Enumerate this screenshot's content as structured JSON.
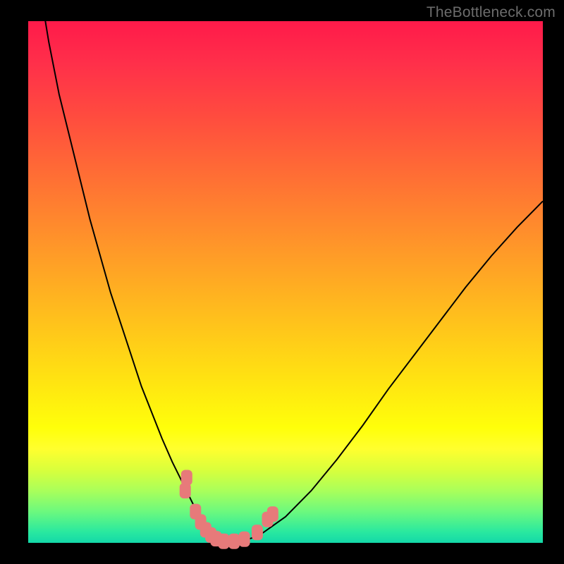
{
  "watermark": "TheBottleneck.com",
  "colors": {
    "frame_bg": "#000000",
    "gradient_top": "#ff1a4a",
    "gradient_bottom": "#14d8a8",
    "curve_stroke": "#000000",
    "marker_fill": "#e77a7a"
  },
  "chart_data": {
    "type": "line",
    "title": "",
    "xlabel": "",
    "ylabel": "",
    "xlim": [
      0,
      100
    ],
    "ylim": [
      0,
      100
    ],
    "x": [
      0,
      2,
      4,
      6,
      8,
      10,
      12,
      14,
      16,
      18,
      20,
      22,
      24,
      26,
      28,
      30,
      32,
      33,
      34,
      35,
      36,
      37,
      38,
      39,
      40,
      42,
      45,
      50,
      55,
      60,
      65,
      70,
      75,
      80,
      85,
      90,
      95,
      100
    ],
    "y": [
      120,
      108,
      96,
      86,
      78,
      70,
      62,
      55,
      48,
      42,
      36,
      30,
      25,
      20,
      15.5,
      11.5,
      7.5,
      5.5,
      4,
      2.8,
      2,
      1.2,
      0.6,
      0.3,
      0.1,
      0.4,
      1.5,
      5,
      10,
      16,
      22.5,
      29.5,
      36,
      42.5,
      49,
      55,
      60.5,
      65.5
    ],
    "markers": [
      {
        "x": 30.5,
        "y": 10.0
      },
      {
        "x": 30.8,
        "y": 12.5
      },
      {
        "x": 32.5,
        "y": 6.0
      },
      {
        "x": 33.5,
        "y": 4.0
      },
      {
        "x": 34.5,
        "y": 2.5
      },
      {
        "x": 35.5,
        "y": 1.5
      },
      {
        "x": 36.5,
        "y": 0.8
      },
      {
        "x": 38.0,
        "y": 0.3
      },
      {
        "x": 40.0,
        "y": 0.3
      },
      {
        "x": 42.0,
        "y": 0.7
      },
      {
        "x": 44.5,
        "y": 2.0
      },
      {
        "x": 46.5,
        "y": 4.5
      },
      {
        "x": 47.5,
        "y": 5.5
      }
    ],
    "note": "Values are approximate, read from pixel positions; x and y are normalized 0–100 across the plot area. The curve goes off the top edge at x≈0 (left) and enters from the right edge at y≈65."
  }
}
